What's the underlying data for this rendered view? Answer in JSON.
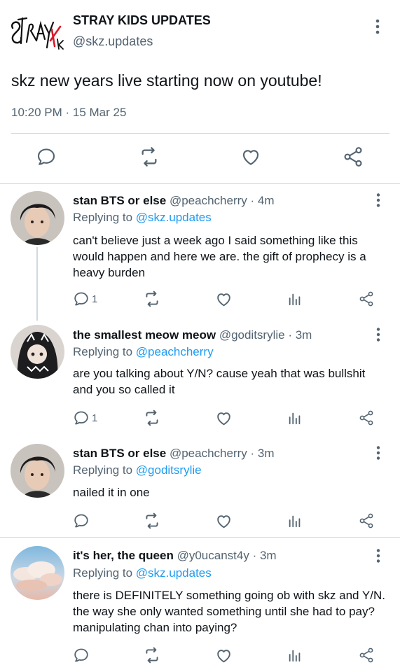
{
  "main_tweet": {
    "author_name": "STRAY KIDS UPDATES",
    "author_handle": "@skz.updates",
    "logo_text": "Stray Kids",
    "text": "skz new years live starting now on youtube!",
    "timestamp": "10:20 PM · 15 Mar 25",
    "actions": [
      "reply-icon",
      "retweet-icon",
      "like-icon",
      "share-icon"
    ]
  },
  "replies": [
    {
      "name": "stan BTS or else",
      "meta": "@peachcherry · 4m",
      "replying_prefix": "Replying to ",
      "replying_to": "@skz.updates",
      "text": "can't believe just a week ago I said something like this would happen and here we are. the gift of prophecy is a heavy burden",
      "reply_count": "1",
      "avatar": "dark-haired-person-avatar"
    },
    {
      "name": "the smallest meow meow",
      "meta": "@goditsrylie · 3m",
      "replying_prefix": "Replying to ",
      "replying_to": "@peachcherry",
      "text": "are you talking about Y/N? cause yeah that was bullshit and you so called it",
      "reply_count": "1",
      "avatar": "hoodie-character-avatar"
    },
    {
      "name": "stan BTS or else",
      "meta": "@peachcherry · 3m",
      "replying_prefix": "Replying to ",
      "replying_to": "@goditsrylie",
      "text": "nailed it in one",
      "reply_count": "",
      "avatar": "dark-haired-person-avatar"
    },
    {
      "name": "it's her, the queen",
      "meta": "@y0ucanst4y · 3m",
      "replying_prefix": "Replying to ",
      "replying_to": "@skz.updates",
      "text": "there is DEFINITELY something going ob with skz and Y/N. the way she only wanted something until she had to pay? manipulating chan into paying?",
      "reply_count": "",
      "avatar": "cloudy-sky-avatar"
    }
  ],
  "colors": {
    "text": "#0f1419",
    "secondary": "#536471",
    "link": "#1d9bf0",
    "divider": "#cfd9de"
  }
}
